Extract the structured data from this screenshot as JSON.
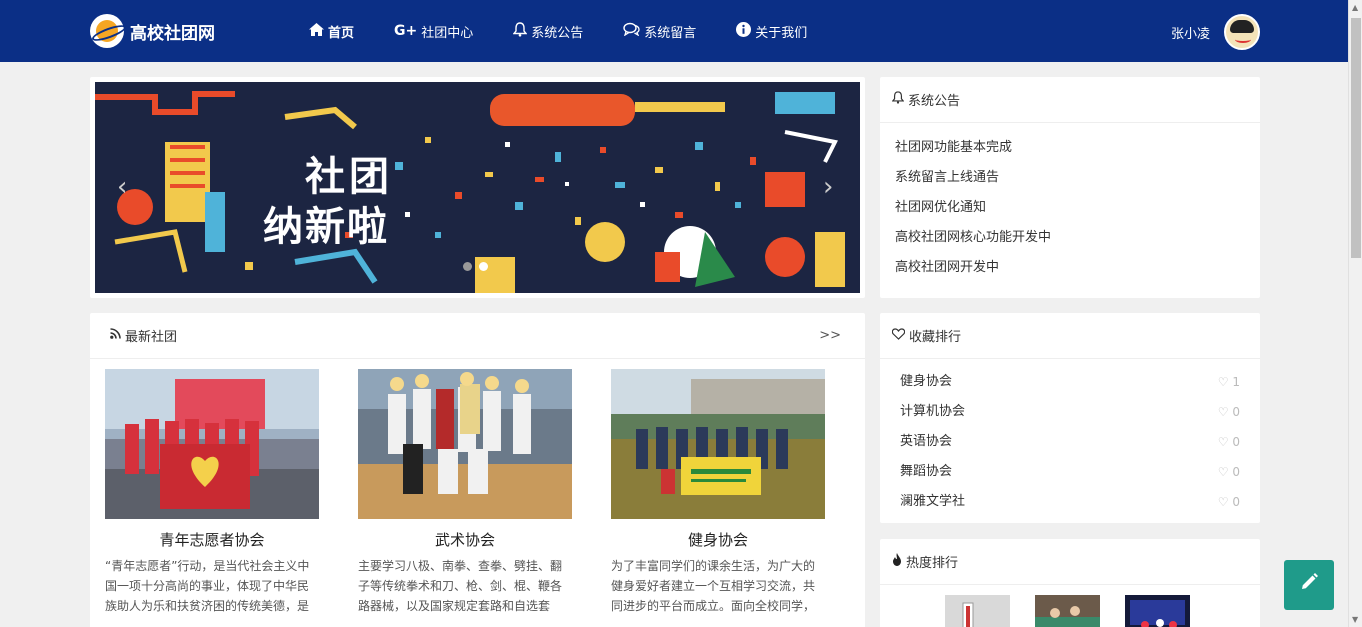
{
  "app": {
    "logo_text": "高校社团网"
  },
  "nav": {
    "items": [
      {
        "label": "首页",
        "icon": "home-icon"
      },
      {
        "label": "社团中心",
        "icon": "google-plus-icon"
      },
      {
        "label": "系统公告",
        "icon": "bell-icon"
      },
      {
        "label": "系统留言",
        "icon": "comments-icon"
      },
      {
        "label": "关于我们",
        "icon": "info-icon"
      }
    ],
    "user_name": "张小凌"
  },
  "banner": {
    "line1": "社团",
    "line2": "纳新啦",
    "prev": "‹",
    "next": "›"
  },
  "notices": {
    "title": "系统公告",
    "items": [
      "社团网功能基本完成",
      "系统留言上线通告",
      "社团网优化通知",
      "高校社团网核心功能开发中",
      "高校社团网开发中"
    ]
  },
  "latest": {
    "title": "最新社团",
    "more": ">>",
    "clubs": [
      {
        "name": "青年志愿者协会",
        "desc": "“青年志愿者”行动，是当代社会主义中国一项十分高尚的事业，体现了中华民族助人为乐和扶贫济困的传统美德，是大"
      },
      {
        "name": "武术协会",
        "desc": "主要学习八极、南拳、查拳、劈挂、翻子等传统拳术和刀、枪、剑、棍、鞭各路器械，以及国家规定套路和自选套"
      },
      {
        "name": "健身协会",
        "desc": "为了丰富同学们的课余生活，为广大的健身爱好者建立一个互相学习交流，共同进步的平台而成立。面向全校同学，"
      }
    ]
  },
  "favorites": {
    "title": "收藏排行",
    "items": [
      {
        "name": "健身协会",
        "count": "1"
      },
      {
        "name": "计算机协会",
        "count": "0"
      },
      {
        "name": "英语协会",
        "count": "0"
      },
      {
        "name": "舞蹈协会",
        "count": "0"
      },
      {
        "name": "澜雅文学社",
        "count": "0"
      }
    ]
  },
  "hot": {
    "title": "热度排行"
  },
  "colors": {
    "nav_bg": "#0b2f86",
    "accent": "#1f9b8a"
  }
}
